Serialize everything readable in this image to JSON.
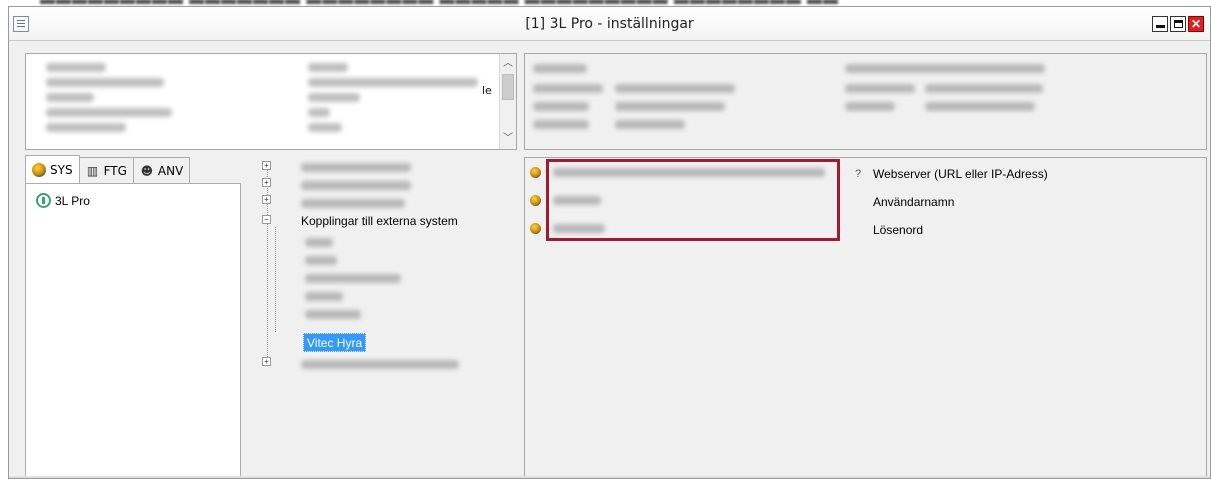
{
  "window": {
    "title": "[1]  3L Pro - inställningar"
  },
  "info_panel": {
    "partial_text": "le"
  },
  "tabs": [
    {
      "label": "SYS",
      "icon": "globe-icon",
      "active": true
    },
    {
      "label": "FTG",
      "icon": "building-icon",
      "active": false
    },
    {
      "label": "ANV",
      "icon": "user-icon",
      "active": false
    }
  ],
  "left_tree": {
    "root_label": "3L Pro"
  },
  "middle_tree": {
    "expanded_group": "Kopplingar till externa system",
    "selected_item": "Vitec Hyra"
  },
  "settings": {
    "fields": [
      {
        "label": "Webserver (URL eller IP-Adress)"
      },
      {
        "label": "Användarnamn"
      },
      {
        "label": "Lösenord"
      }
    ]
  },
  "colors": {
    "highlight_border": "#9e1b32",
    "selection": "#3399ff",
    "window_bg": "#f0f0f0"
  }
}
